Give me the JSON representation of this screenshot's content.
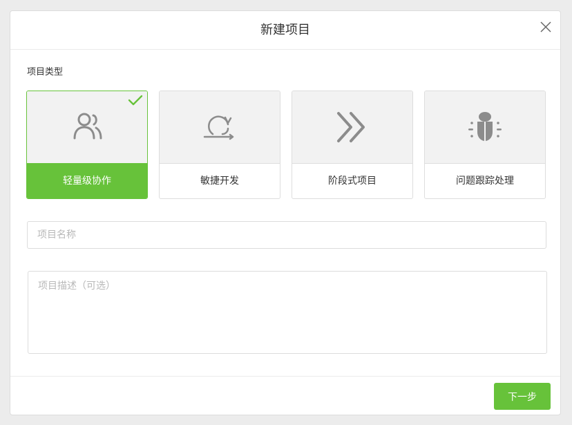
{
  "dialog": {
    "title": "新建项目",
    "close_icon": "close-icon"
  },
  "project_type": {
    "label": "项目类型",
    "options": [
      {
        "label": "轻量级协作",
        "icon": "users-icon",
        "selected": true
      },
      {
        "label": "敏捷开发",
        "icon": "sprint-cycle-icon",
        "selected": false
      },
      {
        "label": "阶段式项目",
        "icon": "double-chevron-right-icon",
        "selected": false
      },
      {
        "label": "问题跟踪处理",
        "icon": "bug-icon",
        "selected": false
      }
    ],
    "selected_check_icon": "checkmark-icon"
  },
  "form": {
    "name_value": "",
    "name_placeholder": "项目名称",
    "description_value": "",
    "description_placeholder": "项目描述（可选）"
  },
  "footer": {
    "next_label": "下一步"
  },
  "colors": {
    "accent": "#67c23a",
    "icon_gray": "#8c8c8c",
    "card_bg": "#f2f2f2",
    "border": "#dddddd"
  }
}
